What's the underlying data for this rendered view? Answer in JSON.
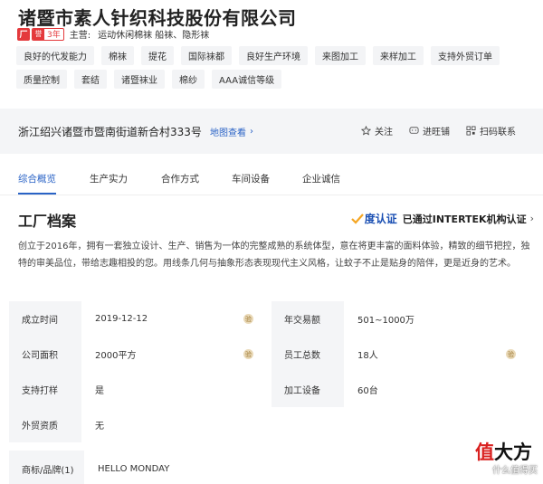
{
  "company": {
    "name": "诸暨市素人针织科技股份有限公司"
  },
  "meta": {
    "shop_mark": "厂",
    "years_icon": "誉",
    "years": "3年",
    "main_label": "主营:",
    "main_items": "运动休闲棉袜 船袜、隐形袜"
  },
  "tags_row1": [
    "良好的代发能力",
    "棉袜",
    "提花",
    "国际袜都",
    "良好生产环境",
    "来图加工",
    "来样加工",
    "支持外贸订单"
  ],
  "tags_row2": [
    "质量控制",
    "套结",
    "诸暨袜业",
    "棉纱",
    "AAA诚信等级"
  ],
  "address": {
    "text": "浙江绍兴诸暨市暨南街道新合村333号",
    "map_link": "地图查看",
    "map_chevron": "›"
  },
  "actions": {
    "follow": "关注",
    "wangwang": "进旺铺",
    "scan": "扫码联系"
  },
  "tabs": [
    "综合概览",
    "生产实力",
    "合作方式",
    "车间设备",
    "企业诚信"
  ],
  "factory": {
    "title": "工厂档案",
    "cert_logo": "度认证",
    "cert_text": "已通过INTERTEK机构认证",
    "cert_chevron": "›",
    "description": "创立于2016年，拥有一套独立设计、生产、销售为一体的完整成熟的系统体型，意在将更丰富的面料体验，精致的细节把控，独特的审美品位，带给志趣相投的您。用线条几何与抽象形态表现现代主义风格，让蚊子不止是贴身的陪伴，更是近身的艺术。"
  },
  "info": {
    "verify_mark": "验",
    "rows": [
      {
        "l1": "成立时间",
        "v1": "2019-12-12",
        "l2": "年交易额",
        "v2": "501~1000万"
      },
      {
        "l1": "公司面积",
        "v1": "2000平方",
        "l2": "员工总数",
        "v2": "18人"
      },
      {
        "l1": "支持打样",
        "v1": "是",
        "l2": "加工设备",
        "v2": "60台"
      },
      {
        "l1": "外贸资质",
        "v1": "无",
        "l2": "",
        "v2": ""
      }
    ],
    "brand_label": "商标/品牌(1)",
    "brand_value": "HELLO MONDAY"
  },
  "watermark": {
    "a": "值",
    "b": "大方",
    "small": "什么值得买"
  },
  "colors": {
    "accent": "#2a63c6",
    "brand_red": "#e4393c",
    "label_bg": "#f4f5f7"
  }
}
